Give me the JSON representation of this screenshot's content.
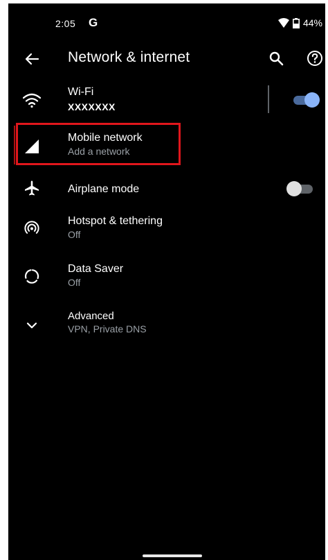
{
  "status": {
    "time": "2:05",
    "carrier_glyph": "G",
    "battery": "44%",
    "icons": [
      "wifi-signal-icon",
      "battery-icon"
    ]
  },
  "appbar": {
    "title": "Network & internet",
    "icons": [
      "back-arrow-icon",
      "search-icon",
      "help-icon"
    ]
  },
  "items": [
    {
      "title": "Wi-Fi",
      "subtitle": "XXXXXXX",
      "icon": "wifi-icon",
      "toggle": "on"
    },
    {
      "title": "Mobile network",
      "subtitle": "Add a network",
      "icon": "signal-icon"
    },
    {
      "title": "Airplane mode",
      "icon": "airplane-icon",
      "toggle": "off"
    },
    {
      "title": "Hotspot & tethering",
      "subtitle": "Off",
      "icon": "hotspot-icon"
    },
    {
      "title": "Data Saver",
      "subtitle": "Off",
      "icon": "data-saver-icon"
    },
    {
      "title": "Advanced",
      "subtitle": "VPN, Private DNS",
      "icon": "chevron-down-icon"
    }
  ],
  "colors": {
    "background": "#000000",
    "text_primary": "#ffffff",
    "text_secondary": "#9aa0a6",
    "accent": "#8ab4f8",
    "highlight": "#e0161c"
  }
}
